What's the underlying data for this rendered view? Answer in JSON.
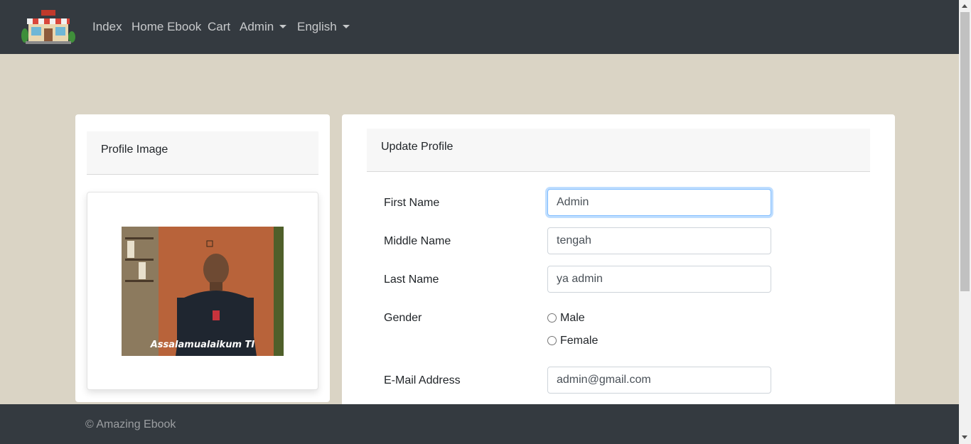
{
  "nav": {
    "items": [
      "Index",
      "Home Ebook",
      "Cart"
    ],
    "admin_label": "Admin",
    "language_label": "English"
  },
  "profile_image": {
    "header": "Profile Image",
    "caption": "Assalamualaikum TI"
  },
  "update_profile": {
    "header": "Update Profile",
    "first_name_label": "First Name",
    "first_name_value": "Admin",
    "middle_name_label": "Middle Name",
    "middle_name_value": "tengah",
    "last_name_label": "Last Name",
    "last_name_value": "ya admin",
    "gender_label": "Gender",
    "gender_options": [
      "Male",
      "Female"
    ],
    "email_label": "E-Mail Address",
    "email_value": "admin@gmail.com"
  },
  "footer": {
    "text": "© Amazing Ebook"
  },
  "colors": {
    "navbar": "#343a40",
    "page_background": "#dad4c5",
    "focus_border": "#80bdff"
  }
}
